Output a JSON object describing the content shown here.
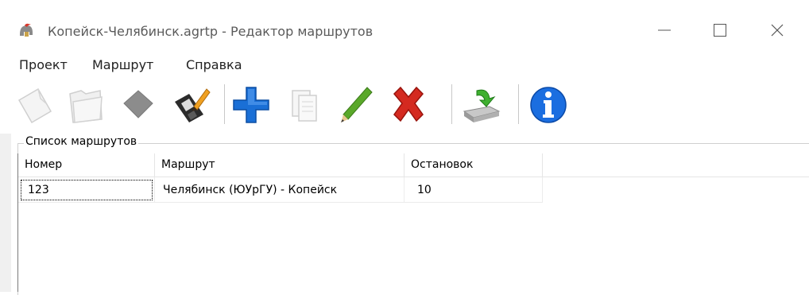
{
  "window": {
    "title": "Копейск-Челябинск.agrtp - Редактор маршрутов",
    "icon": "helmet-icon",
    "controls": [
      "minimize-icon",
      "maximize-icon",
      "close-icon"
    ]
  },
  "menu": {
    "items": [
      "Проект",
      "Маршрут",
      "Справка"
    ]
  },
  "toolbar": {
    "buttons": [
      {
        "icon": "new-file-icon",
        "enabled": false
      },
      {
        "icon": "open-folder-icon",
        "enabled": false
      },
      {
        "icon": "stop-icon",
        "enabled": false
      },
      {
        "icon": "save-edit-icon",
        "enabled": true
      },
      {
        "icon": "add-icon",
        "enabled": true
      },
      {
        "icon": "copy-icon",
        "enabled": false
      },
      {
        "icon": "edit-pencil-icon",
        "enabled": true
      },
      {
        "icon": "delete-icon",
        "enabled": true
      },
      {
        "icon": "import-icon",
        "enabled": true
      },
      {
        "icon": "info-icon",
        "enabled": true
      }
    ]
  },
  "routes_group": {
    "title": "Список маршрутов",
    "columns": [
      "Номер",
      "Маршрут",
      "Остановок"
    ],
    "rows": [
      {
        "number": "123",
        "route": "Челябинск (ЮУрГУ) - Копейск",
        "stops": "10"
      }
    ]
  },
  "colors": {
    "add_blue": "#1a6fd6",
    "delete_red": "#d42a20",
    "pencil_green": "#5aa82a",
    "info_blue": "#1b6ee0"
  }
}
